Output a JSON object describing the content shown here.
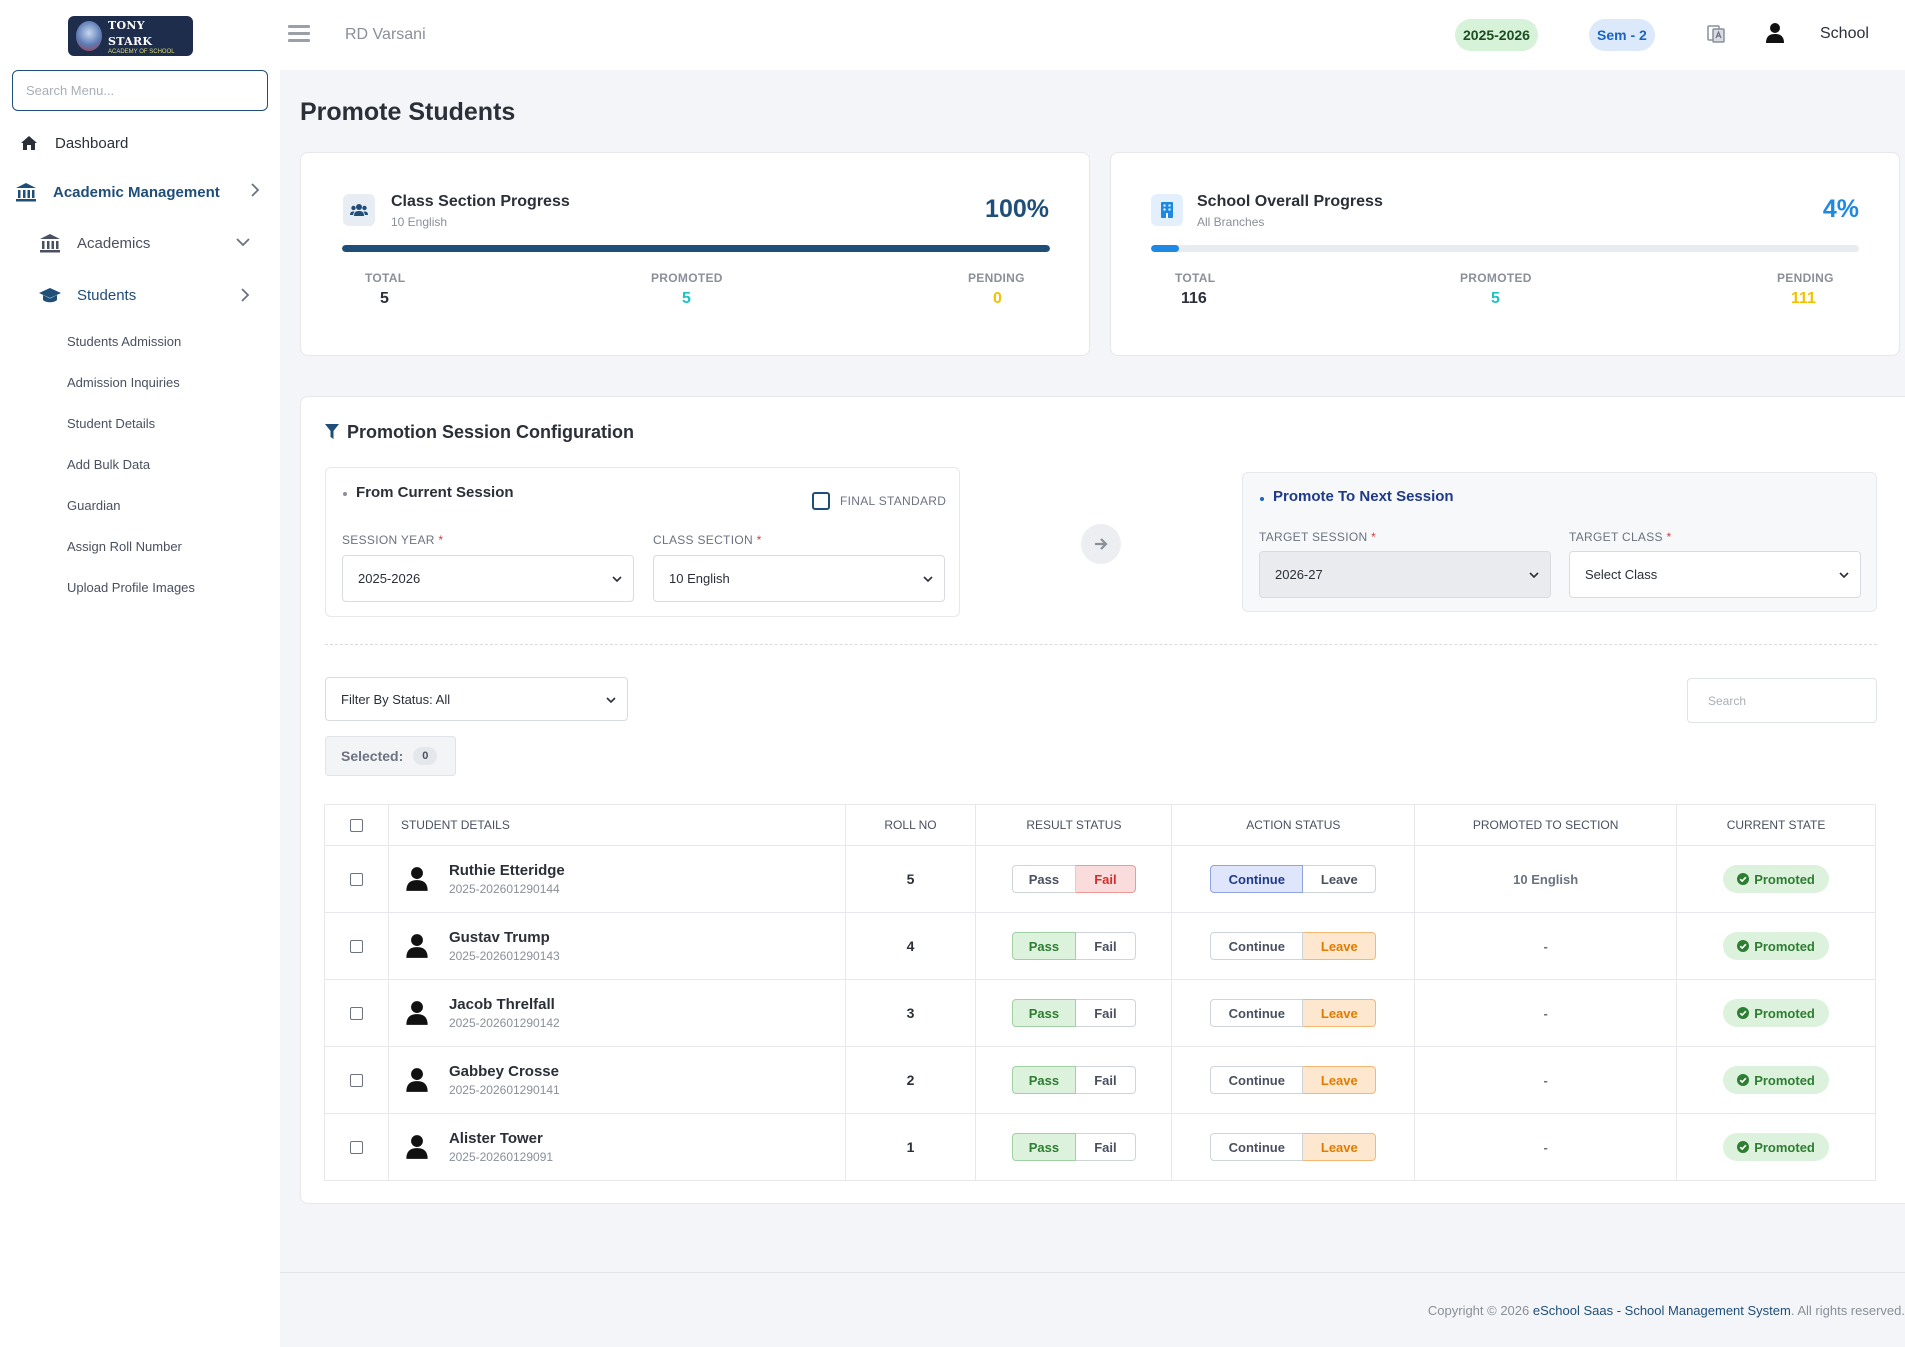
{
  "brand": {
    "logo_text": "TONY STARK",
    "logo_sub": "ACADEMY OF SCHOOL"
  },
  "sidebar": {
    "search_placeholder": "Search Menu...",
    "dashboard": "Dashboard",
    "academic_management": "Academic Management",
    "academics": "Academics",
    "students": "Students",
    "sub_items": [
      "Students Admission",
      "Admission Inquiries",
      "Student Details",
      "Add Bulk Data",
      "Guardian",
      "Assign Roll Number",
      "Upload Profile Images"
    ]
  },
  "topbar": {
    "school_name": "RD Varsani",
    "session_year": "2025-2026",
    "semester": "Sem - 2",
    "user_label": "School"
  },
  "page": {
    "title": "Promote Students"
  },
  "class_progress": {
    "title": "Class Section Progress",
    "subtitle": "10 English",
    "percent_label": "100%",
    "percent": 100,
    "total_label": "TOTAL",
    "total": "5",
    "promoted_label": "PROMOTED",
    "promoted": "5",
    "pending_label": "PENDING",
    "pending": "0"
  },
  "school_progress": {
    "title": "School Overall Progress",
    "subtitle": "All Branches",
    "percent_label": "4%",
    "percent": 4,
    "total_label": "TOTAL",
    "total": "116",
    "promoted_label": "PROMOTED",
    "promoted": "5",
    "pending_label": "PENDING",
    "pending": "111"
  },
  "config": {
    "title": "Promotion Session Configuration",
    "from": {
      "title": "From Current Session",
      "final_standard": "FINAL STANDARD",
      "session_year_label": "SESSION YEAR",
      "session_year_value": "2025-2026",
      "class_section_label": "CLASS SECTION",
      "class_section_value": "10 English"
    },
    "to": {
      "title": "Promote To Next Session",
      "target_session_label": "TARGET SESSION",
      "target_session_value": "2026-27",
      "target_class_label": "TARGET CLASS",
      "target_class_value": "Select Class"
    },
    "required_mark": "*"
  },
  "filters": {
    "status_filter": "Filter By Status: All",
    "search_placeholder": "Search",
    "selected_label": "Selected:",
    "selected_count": "0"
  },
  "table": {
    "headers": [
      "STUDENT DETAILS",
      "ROLL NO",
      "RESULT STATUS",
      "ACTION STATUS",
      "PROMOTED TO SECTION",
      "CURRENT STATE"
    ],
    "pass_label": "Pass",
    "fail_label": "Fail",
    "continue_label": "Continue",
    "leave_label": "Leave",
    "rows": [
      {
        "name": "Ruthie Etteridge",
        "id": "2025-202601290144",
        "roll": "5",
        "result": "Fail",
        "action": "Continue",
        "promoted_to": "10 English",
        "state": "Promoted"
      },
      {
        "name": "Gustav Trump",
        "id": "2025-202601290143",
        "roll": "4",
        "result": "Pass",
        "action": "Leave",
        "promoted_to": "-",
        "state": "Promoted"
      },
      {
        "name": "Jacob Threlfall",
        "id": "2025-202601290142",
        "roll": "3",
        "result": "Pass",
        "action": "Leave",
        "promoted_to": "-",
        "state": "Promoted"
      },
      {
        "name": "Gabbey Crosse",
        "id": "2025-202601290141",
        "roll": "2",
        "result": "Pass",
        "action": "Leave",
        "promoted_to": "-",
        "state": "Promoted"
      },
      {
        "name": "Alister Tower",
        "id": "2025-20260129091",
        "roll": "1",
        "result": "Pass",
        "action": "Leave",
        "promoted_to": "-",
        "state": "Promoted"
      }
    ]
  },
  "footer": {
    "prefix": "Copyright © 2026 ",
    "brand": "eSchool Saas - School Management System",
    "suffix": ". All rights reserved."
  },
  "colors": {
    "primary": "#1f4e79",
    "class_bar": "#1f4e79",
    "school_bar": "#1e88e5",
    "promoted": "#1ec1c6",
    "pending": "#f2c200",
    "pass": "#2e7d32",
    "fail": "#d32f2f",
    "leave": "#e07b00"
  }
}
